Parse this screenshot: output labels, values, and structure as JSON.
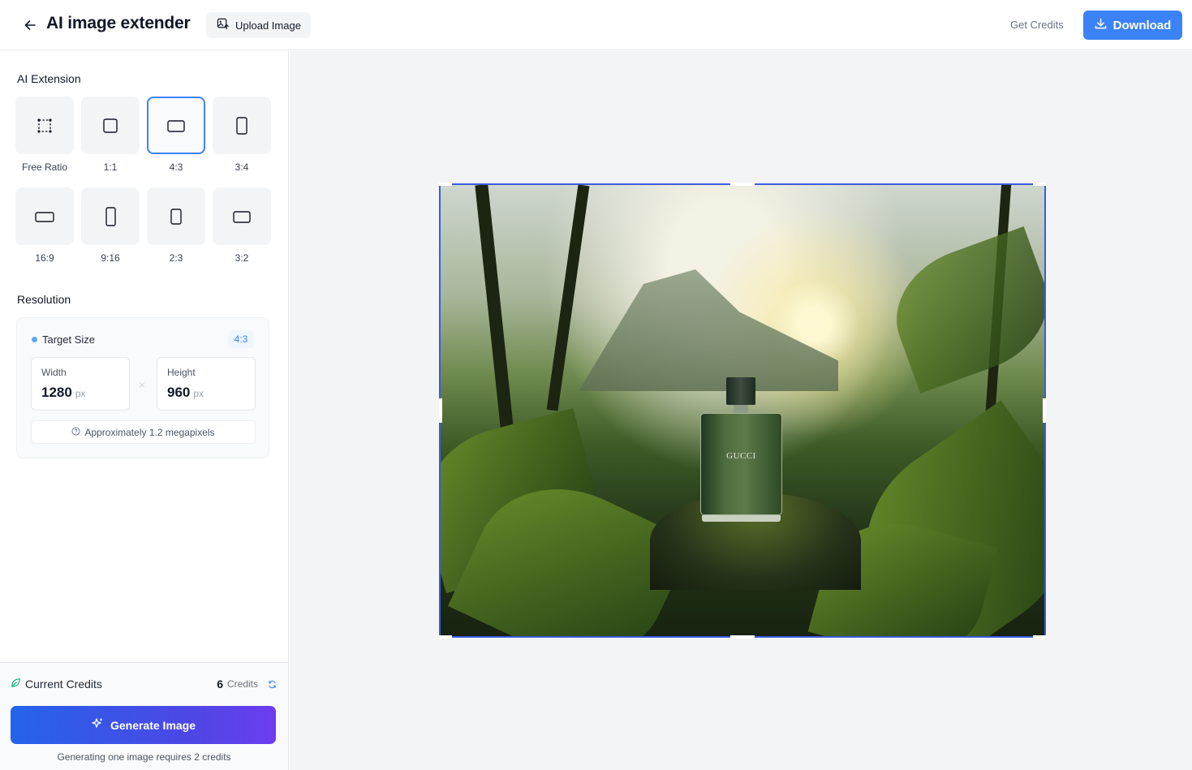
{
  "header": {
    "title": "AI image extender",
    "upload_label": "Upload Image",
    "get_credits_label": "Get Credits",
    "download_label": "Download"
  },
  "sidebar": {
    "extension_title": "AI Extension",
    "ratios": [
      {
        "label": "Free Ratio",
        "icon": "free-ratio-icon",
        "selected": false
      },
      {
        "label": "1:1",
        "icon": "square-icon",
        "selected": false
      },
      {
        "label": "4:3",
        "icon": "landscape-icon",
        "selected": true
      },
      {
        "label": "3:4",
        "icon": "portrait-icon",
        "selected": false
      },
      {
        "label": "16:9",
        "icon": "wide-icon",
        "selected": false
      },
      {
        "label": "9:16",
        "icon": "tall-icon",
        "selected": false
      },
      {
        "label": "2:3",
        "icon": "portrait-icon",
        "selected": false
      },
      {
        "label": "3:2",
        "icon": "landscape-icon",
        "selected": false
      }
    ],
    "resolution_title": "Resolution",
    "resolution": {
      "target_label": "Target Size",
      "ratio_badge": "4:3",
      "width_label": "Width",
      "width_value": "1280",
      "height_label": "Height",
      "height_value": "960",
      "unit": "px",
      "times": "×",
      "megapixels": "Approximately 1.2 megapixels"
    },
    "footer": {
      "credits_label": "Current Credits",
      "credits_value": "6",
      "credits_unit": "Credits",
      "generate_label": "Generate Image",
      "note": "Generating one image requires 2 credits"
    }
  },
  "canvas": {
    "product_brand": "GUCCI"
  },
  "colors": {
    "accent": "#3b82f6",
    "generate_gradient_start": "#2563eb",
    "generate_gradient_end": "#6d3df0",
    "canvas_bg": "#f3f4f6"
  }
}
